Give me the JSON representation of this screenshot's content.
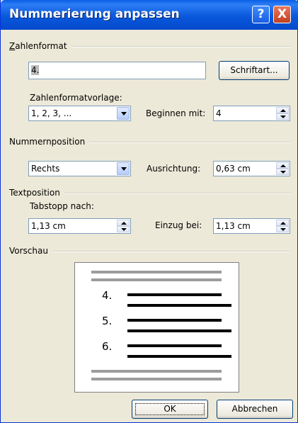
{
  "window": {
    "title": "Nummerierung anpassen",
    "help_glyph": "?",
    "close_glyph": "X"
  },
  "zahlenformat": {
    "group_label": "Zahlenformat",
    "value": "4.",
    "font_button": "Schriftart...",
    "style_label": "Zahlenformatvorlage:",
    "style_value": "1, 2, 3, ...",
    "start_label": "Beginnen mit:",
    "start_value": "4"
  },
  "nummernposition": {
    "group_label": "Nummernposition",
    "align_value": "Rechts",
    "ausrichtung_label": "Ausrichtung:",
    "ausrichtung_value": "0,63 cm"
  },
  "textposition": {
    "group_label": "Textposition",
    "tab_label": "Tabstopp nach:",
    "tab_value": "1,13 cm",
    "einzug_label": "Einzug bei:",
    "einzug_value": "1,13 cm"
  },
  "vorschau": {
    "group_label": "Vorschau",
    "numbers": [
      "4.",
      "5.",
      "6."
    ]
  },
  "buttons": {
    "ok": "OK",
    "cancel": "Abbrechen"
  }
}
